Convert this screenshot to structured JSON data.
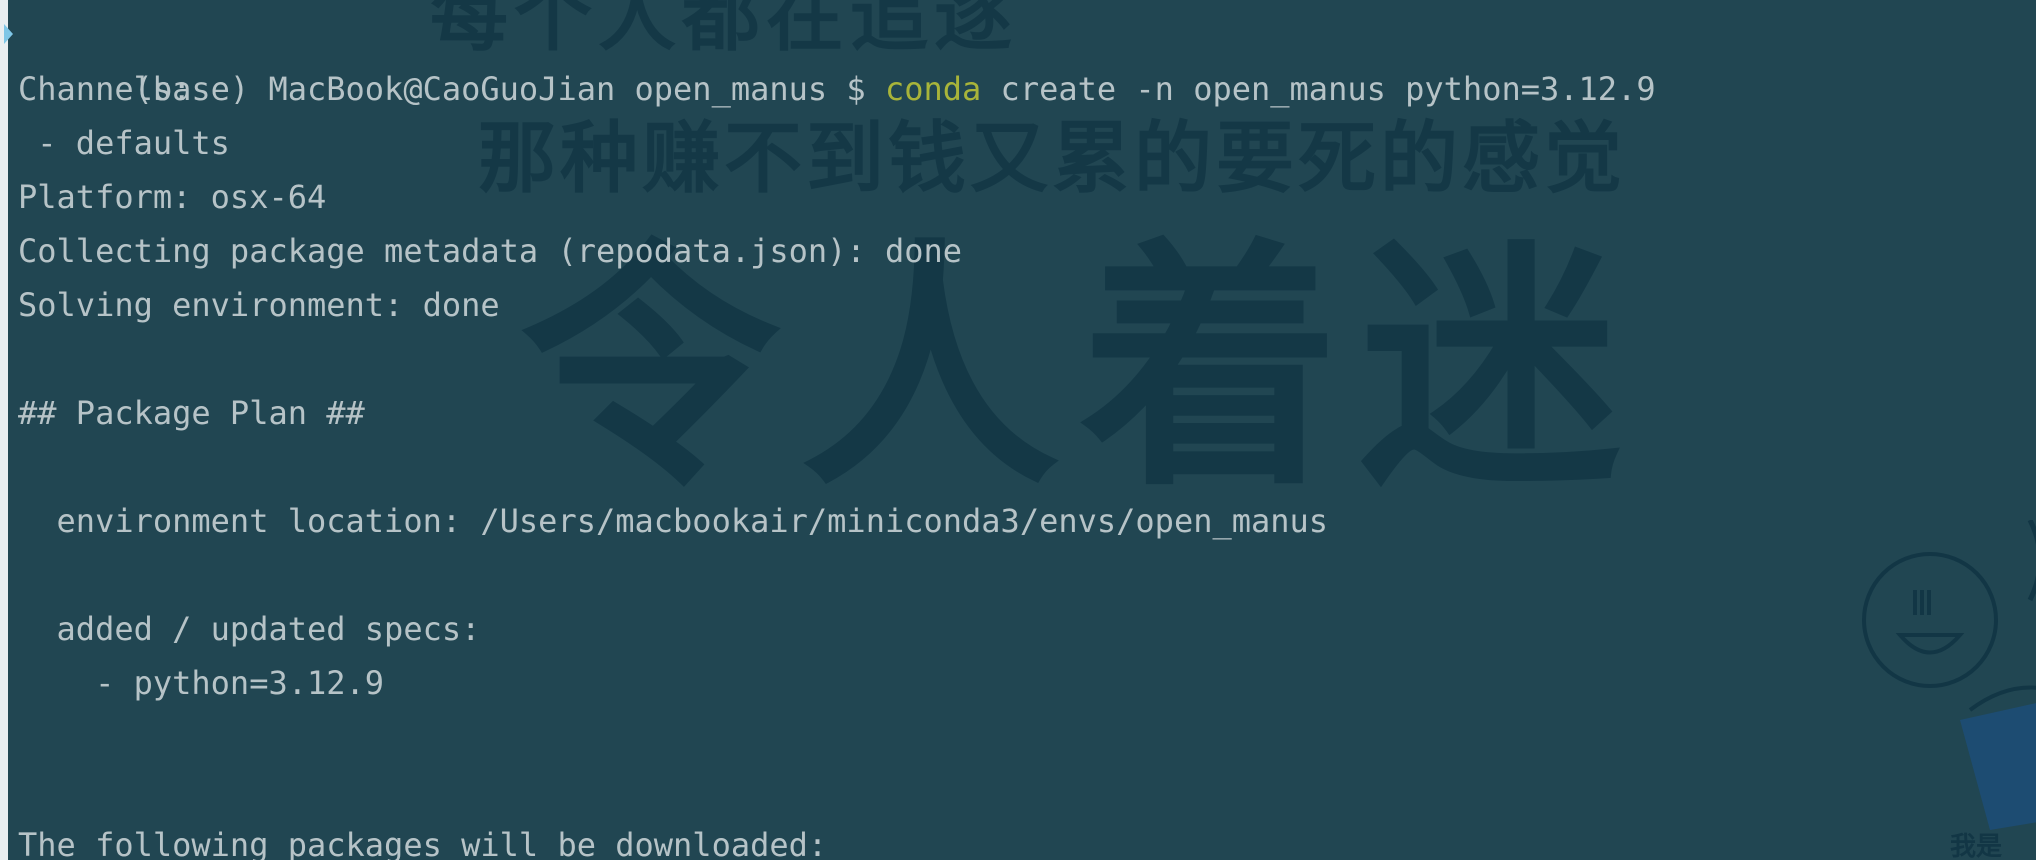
{
  "colors": {
    "background": "#214652",
    "text": "#b6c3c7",
    "command_accent": "#a8b43a",
    "watermark": "#123645",
    "cursor_marker": "#7fc6e6"
  },
  "icons": {
    "prompt_marker": "triangle-right-icon"
  },
  "watermark": {
    "top_line": "每个人都在追逐",
    "middle_line": "那种赚不到钱又累的要死的感觉",
    "big_line": "令人着迷",
    "doodle_caption": "我是"
  },
  "terminal": {
    "prompt": "(base) MacBook@CaoGuoJian open_manus $ ",
    "command": "conda",
    "command_args": " create -n open_manus python=3.12.9",
    "lines": [
      "Channels:",
      " - defaults",
      "Platform: osx-64",
      "Collecting package metadata (repodata.json): done",
      "Solving environment: done",
      "",
      "## Package Plan ##",
      "",
      "  environment location: /Users/macbookair/miniconda3/envs/open_manus",
      "",
      "  added / updated specs:",
      "    - python=3.12.9",
      "",
      "",
      "The following packages will be downloaded:"
    ]
  }
}
